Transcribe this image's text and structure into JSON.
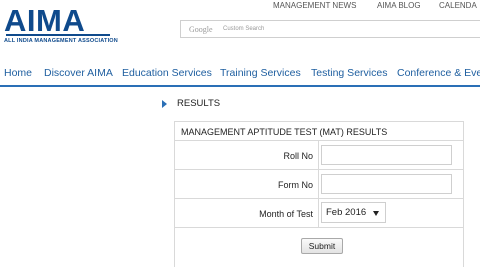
{
  "brand": {
    "logo_text": "AIMA",
    "logo_subtitle": "ALL INDIA MANAGEMENT ASSOCIATION",
    "accent": "#2a6fb6",
    "logo_color": "#0f4a8c"
  },
  "top_links": [
    "MANAGEMENT NEWS",
    "AIMA BLOG",
    "CALENDA"
  ],
  "search": {
    "google_label": "Google",
    "placeholder": "Custom Search"
  },
  "nav": {
    "items": [
      "Home",
      "Discover AIMA",
      "Education Services",
      "Training Services",
      "Testing Services",
      "Conference & Eve"
    ]
  },
  "results": {
    "title": "RESULTS",
    "form_title": "MANAGEMENT APTITUDE TEST (MAT) RESULTS",
    "fields": [
      {
        "label": "Roll No",
        "value": ""
      },
      {
        "label": "Form No",
        "value": ""
      },
      {
        "label": "Month of Test",
        "value": "Feb 2016"
      }
    ],
    "submit_label": "Submit"
  }
}
